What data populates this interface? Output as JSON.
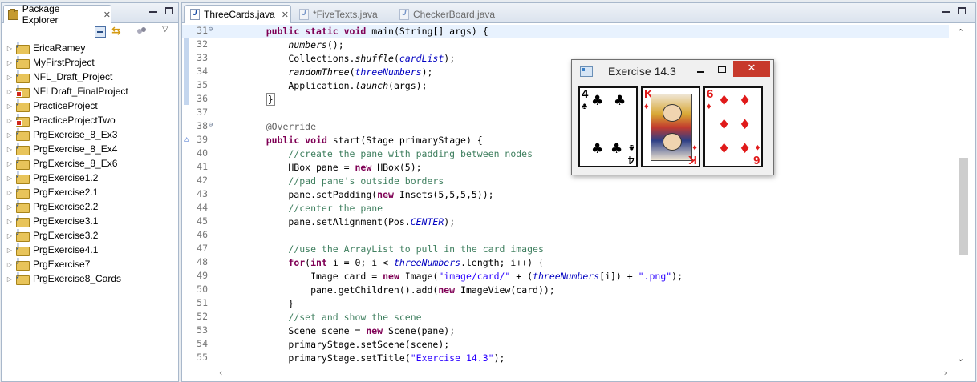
{
  "package_explorer": {
    "tab_label": "Package Explorer",
    "projects": [
      {
        "name": "EricaRamey",
        "error": false
      },
      {
        "name": "MyFirstProject",
        "error": false
      },
      {
        "name": "NFL_Draft_Project",
        "error": false
      },
      {
        "name": "NFLDraft_FinalProject",
        "error": true
      },
      {
        "name": "PracticeProject",
        "error": false
      },
      {
        "name": "PracticeProjectTwo",
        "error": true
      },
      {
        "name": "PrgExercise_8_Ex3",
        "error": false
      },
      {
        "name": "PrgExercise_8_Ex4",
        "error": false
      },
      {
        "name": "PrgExercise_8_Ex6",
        "error": false
      },
      {
        "name": "PrgExercise1.2",
        "error": false
      },
      {
        "name": "PrgExercise2.1",
        "error": false
      },
      {
        "name": "PrgExercise2.2",
        "error": false
      },
      {
        "name": "PrgExercise3.1",
        "error": false
      },
      {
        "name": "PrgExercise3.2",
        "error": false
      },
      {
        "name": "PrgExercise4.1",
        "error": false
      },
      {
        "name": "PrgExercise7",
        "error": false
      },
      {
        "name": "PrgExercise8_Cards",
        "error": false
      }
    ]
  },
  "editor": {
    "tabs": [
      {
        "label": "ThreeCards.java",
        "active": true
      },
      {
        "label": "*FiveTexts.java",
        "active": false
      },
      {
        "label": "CheckerBoard.java",
        "active": false
      }
    ],
    "lines": [
      {
        "num": "31",
        "fold": "⊖",
        "current": true,
        "html": "    <span class=\"kw\">public static void</span> main(String[] args) {"
      },
      {
        "num": "32",
        "html": "        <span class=\"sm\">numbers</span>();"
      },
      {
        "num": "33",
        "html": "        Collections.<span class=\"sm\">shuffle</span>(<span class=\"fld\">cardList</span>);"
      },
      {
        "num": "34",
        "html": "        <span class=\"sm\">randomThree</span>(<span class=\"fld\">threeNumbers</span>);"
      },
      {
        "num": "35",
        "html": "        Application.<span class=\"sm\">launch</span>(args);"
      },
      {
        "num": "36",
        "html": "    <span class=\"bracket\">}</span>"
      },
      {
        "num": "37",
        "html": ""
      },
      {
        "num": "38",
        "fold": "⊖",
        "html": "    <span class=\"ann\">@Override</span>"
      },
      {
        "num": "39",
        "override": true,
        "html": "    <span class=\"kw\">public void</span> start(Stage primaryStage) {"
      },
      {
        "num": "40",
        "html": "        <span class=\"cm\">//create the pane with padding between nodes</span>"
      },
      {
        "num": "41",
        "html": "        HBox pane = <span class=\"kw\">new</span> HBox(5);"
      },
      {
        "num": "42",
        "html": "        <span class=\"cm\">//pad pane's outside borders</span>"
      },
      {
        "num": "43",
        "html": "        pane.setPadding(<span class=\"kw\">new</span> Insets(5,5,5,5));"
      },
      {
        "num": "44",
        "html": "        <span class=\"cm\">//center the pane</span>"
      },
      {
        "num": "45",
        "html": "        pane.setAlignment(Pos.<span class=\"fld\">CENTER</span>);"
      },
      {
        "num": "46",
        "html": ""
      },
      {
        "num": "47",
        "html": "        <span class=\"cm\">//use the ArrayList to pull in the card images</span>"
      },
      {
        "num": "48",
        "html": "        <span class=\"kw\">for</span>(<span class=\"kw\">int</span> i = 0; i &lt; <span class=\"fld\">threeNumbers</span>.length; i++) {"
      },
      {
        "num": "49",
        "html": "            Image card = <span class=\"kw\">new</span> Image(<span class=\"st\">\"image/card/\"</span> + (<span class=\"fld\">threeNumbers</span>[i]) + <span class=\"st\">\".png\"</span>);"
      },
      {
        "num": "50",
        "html": "            pane.getChildren().add(<span class=\"kw\">new</span> ImageView(card));"
      },
      {
        "num": "51",
        "html": "        }"
      },
      {
        "num": "52",
        "html": "        <span class=\"cm\">//set and show the scene</span>"
      },
      {
        "num": "53",
        "html": "        Scene scene = <span class=\"kw\">new</span> Scene(pane);"
      },
      {
        "num": "54",
        "html": "        primaryStage.setScene(scene);"
      },
      {
        "num": "55",
        "html": "        primaryStage.setTitle(<span class=\"st\">\"Exercise 14.3\"</span>);"
      }
    ]
  },
  "fx_window": {
    "title": "Exercise 14.3",
    "close_glyph": "✕",
    "cards": [
      {
        "rank": "4",
        "suit": "♣",
        "color": "black"
      },
      {
        "rank": "K",
        "suit": "♦",
        "color": "red"
      },
      {
        "rank": "6",
        "suit": "♦",
        "color": "red"
      }
    ]
  },
  "icons": {
    "package_explorer_tab": "package-explorer-icon",
    "java_file": "java-file-icon",
    "project": "java-project-folder-icon"
  }
}
